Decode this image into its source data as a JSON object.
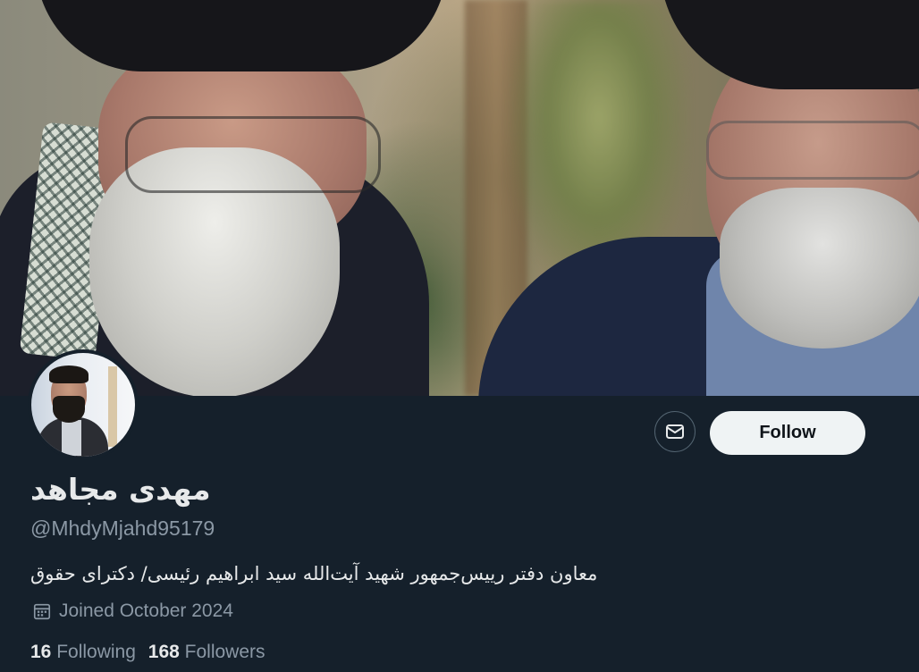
{
  "profile": {
    "display_name": "مهدی مجاهد",
    "handle": "@MhdyMjahd95179",
    "bio": "معاون دفتر رییس‌جمهور شهید آیت‌الله سید ابراهیم رئیسی/ دکترای حقوق",
    "joined": "Joined October 2024",
    "following_count": "16",
    "following_label": "Following",
    "followers_count": "168",
    "followers_label": "Followers"
  },
  "actions": {
    "follow_label": "Follow",
    "message_icon": "mail-icon"
  },
  "icons": {
    "joined_icon": "calendar-icon"
  },
  "colors": {
    "background": "#15202b",
    "follow_button_bg": "#eff3f4",
    "muted_text": "#8b98a5"
  }
}
